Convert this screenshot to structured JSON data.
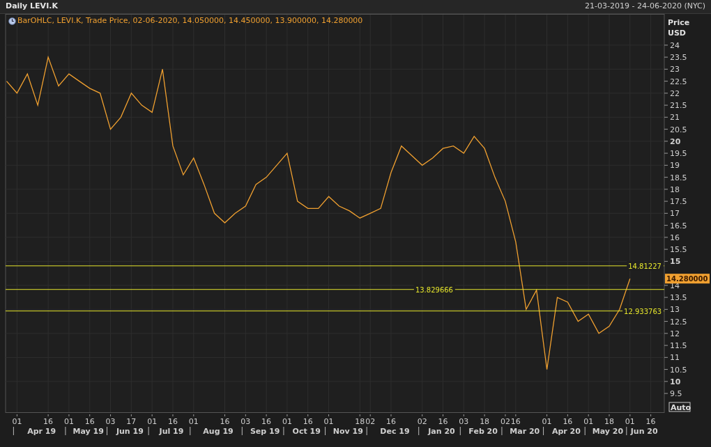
{
  "header": {
    "title": "Daily LEVI.K",
    "range": "21-03-2019 - 24-06-2020 (NYC)"
  },
  "legend": {
    "text": "BarOHLC, LEVI.K, Trade Price, 02-06-2020, 14.050000, 14.450000, 13.900000, 14.280000"
  },
  "axis": {
    "title": "Price",
    "unit": "USD",
    "auto_button": "Auto",
    "last_price": "14.280000"
  },
  "months": [
    "Apr 19",
    "May 19",
    "Jun 19",
    "Jul 19",
    "Aug 19",
    "Sep 19",
    "Oct 19",
    "Nov 19",
    "Dec 19",
    "Jan 20",
    "Feb 20",
    "Mar 20",
    "Apr 20",
    "May 20",
    "Jun 20"
  ],
  "chart_data": {
    "type": "line",
    "grid": true,
    "ylim": [
      8.72,
      25.3
    ],
    "ref_lines": [
      {
        "axis": "y",
        "value": 14.81227,
        "label": "14.81227",
        "color": "#e6e62c"
      },
      {
        "axis": "y",
        "value": 13.829666,
        "label": "13.829666",
        "color": "#e6e62c"
      },
      {
        "axis": "y",
        "value": 12.933763,
        "label": "12.933763",
        "color": "#e6e62c"
      }
    ],
    "categories": [
      null,
      "01",
      null,
      null,
      "16",
      null,
      "01",
      null,
      "16",
      null,
      "03",
      null,
      "17",
      null,
      "01",
      null,
      "16",
      null,
      "01",
      null,
      null,
      "16",
      null,
      "03",
      null,
      "16",
      null,
      "01",
      null,
      "16",
      null,
      "01",
      null,
      null,
      "18",
      "02",
      null,
      "16",
      null,
      null,
      "02",
      null,
      "16",
      null,
      "03",
      null,
      "18",
      null,
      "02",
      "16",
      null,
      null,
      "01",
      null,
      "16",
      null,
      "01",
      null,
      "18",
      null,
      "01",
      null,
      "16",
      null
    ],
    "series": [
      {
        "color": "#f0a030",
        "values": [
          22.5,
          22,
          22.8,
          21.5,
          23.5,
          22.3,
          22.8,
          22.5,
          22.2,
          22,
          20.5,
          21,
          22,
          21.5,
          21.2,
          23,
          19.8,
          18.6,
          19.3,
          18.2,
          17,
          16.6,
          17,
          17.3,
          18.2,
          18.5,
          19,
          19.5,
          17.5,
          17.2,
          17.2,
          17.7,
          17.3,
          17.1,
          16.8,
          17,
          17.2,
          18.7,
          19.8,
          19.4,
          19,
          19.3,
          19.7,
          19.8,
          19.5,
          20.2,
          19.7,
          18.5,
          17.5,
          15.8,
          13,
          13.8,
          10.5,
          13.5,
          13.3,
          12.5,
          12.8,
          12,
          12.3,
          13,
          14.28,
          null,
          null,
          null
        ]
      }
    ],
    "yticks": [
      {
        "value": 24,
        "label": "24"
      },
      {
        "value": 23.5,
        "label": "23.5"
      },
      {
        "value": 23,
        "label": "23"
      },
      {
        "value": 22.5,
        "label": "22.5"
      },
      {
        "value": 22,
        "label": "22"
      },
      {
        "value": 21.5,
        "label": "21.5"
      },
      {
        "value": 21,
        "label": "21"
      },
      {
        "value": 20.5,
        "label": "20.5"
      },
      {
        "value": 20,
        "label": "20"
      },
      {
        "value": 19.5,
        "label": "19.5"
      },
      {
        "value": 19,
        "label": "19"
      },
      {
        "value": 18.5,
        "label": "18.5"
      },
      {
        "value": 18,
        "label": "18"
      },
      {
        "value": 17.5,
        "label": "17.5"
      },
      {
        "value": 17,
        "label": "17"
      },
      {
        "value": 16.5,
        "label": "16.5"
      },
      {
        "value": 16,
        "label": "16"
      },
      {
        "value": 15.5,
        "label": "15.5"
      },
      {
        "value": 15,
        "label": "15"
      },
      {
        "value": 14,
        "label": "14"
      },
      {
        "value": 13.5,
        "label": "13.5"
      },
      {
        "value": 13,
        "label": "13"
      },
      {
        "value": 12.5,
        "label": "12.5"
      },
      {
        "value": 12,
        "label": "12"
      },
      {
        "value": 11.5,
        "label": "11.5"
      },
      {
        "value": 11,
        "label": "11"
      },
      {
        "value": 10.5,
        "label": "10.5"
      },
      {
        "value": 10,
        "label": "10"
      },
      {
        "value": 9.5,
        "label": "9.5"
      }
    ]
  }
}
